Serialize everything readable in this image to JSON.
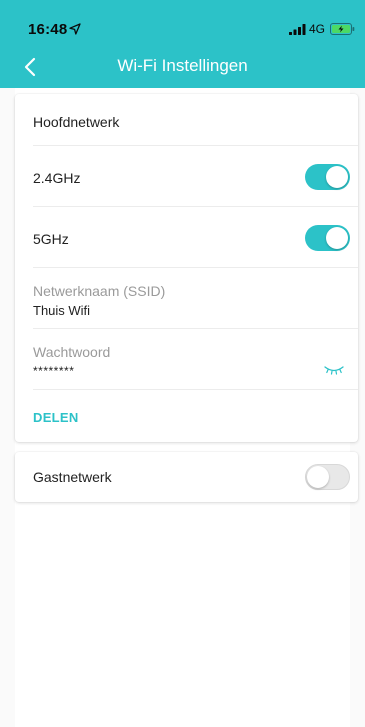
{
  "status_bar": {
    "time": "16:48",
    "network": "4G"
  },
  "nav": {
    "title": "Wi-Fi Instellingen"
  },
  "main_network": {
    "heading": "Hoofdnetwerk",
    "band_24": {
      "label": "2.4GHz",
      "enabled": true
    },
    "band_5": {
      "label": "5GHz",
      "enabled": true
    },
    "ssid": {
      "label": "Netwerknaam (SSID)",
      "value": "Thuis Wifi"
    },
    "password": {
      "label": "Wachtwoord",
      "value": "********"
    },
    "share_label": "DELEN"
  },
  "guest_network": {
    "label": "Gastnetwerk",
    "enabled": false
  },
  "colors": {
    "accent": "#2cc2c8",
    "toggle_off": "#e8e8e8",
    "muted_text": "#9a9a9a"
  },
  "icons": {
    "back": "chevron-left-icon",
    "location": "location-arrow-icon",
    "signal": "cellular-signal-icon",
    "battery": "battery-charging-icon",
    "password_visibility": "eye-closed-icon"
  }
}
